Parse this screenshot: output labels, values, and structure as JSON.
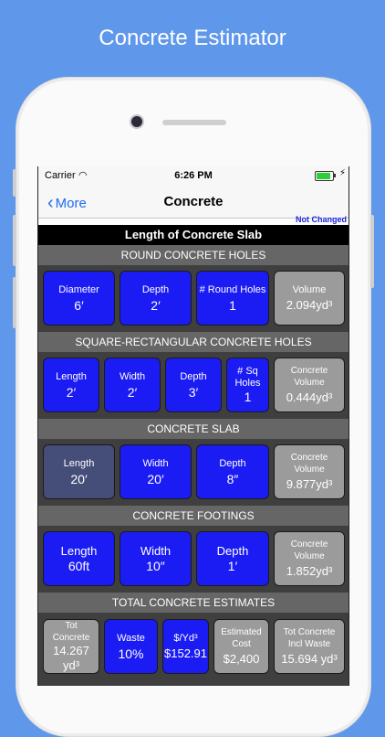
{
  "headline": "Concrete Estimator",
  "status": {
    "carrier": "Carrier",
    "time": "6:26 PM"
  },
  "nav": {
    "back": "More",
    "title": "Concrete"
  },
  "note": "Not Changed",
  "title": "Length of Concrete Slab",
  "round_holes": {
    "header": "ROUND CONCRETE HOLES",
    "diameter": {
      "label": "Diameter",
      "value": "6′"
    },
    "depth": {
      "label": "Depth",
      "value": "2′"
    },
    "count": {
      "label": "# Round Holes",
      "value": "1"
    },
    "volume": {
      "label": "Volume",
      "value": "2.094yd³"
    }
  },
  "square_holes": {
    "header": "SQUARE-RECTANGULAR  CONCRETE HOLES",
    "length": {
      "label": "Length",
      "value": "2′"
    },
    "width": {
      "label": "Width",
      "value": "2′"
    },
    "depth": {
      "label": "Depth",
      "value": "3′"
    },
    "count": {
      "label1": "# Sq",
      "label2": "Holes",
      "value": "1"
    },
    "volume": {
      "label1": "Concrete",
      "label2": "Volume",
      "value": "0.444yd³"
    }
  },
  "slab": {
    "header": "CONCRETE SLAB",
    "length": {
      "label": "Length",
      "value": "20′"
    },
    "width": {
      "label": "Width",
      "value": "20′"
    },
    "depth": {
      "label": "Depth",
      "value": "8″"
    },
    "volume": {
      "label1": "Concrete",
      "label2": "Volume",
      "value": "9.877yd³"
    }
  },
  "footings": {
    "header": "CONCRETE FOOTINGS",
    "length": {
      "label": "Length",
      "value": "60ft"
    },
    "width": {
      "label": "Width",
      "value": "10″"
    },
    "depth": {
      "label": "Depth",
      "value": "1′"
    },
    "volume": {
      "label1": "Concrete",
      "label2": "Volume",
      "value": "1.852yd³"
    }
  },
  "totals": {
    "header": "TOTAL CONCRETE ESTIMATES",
    "tot": {
      "label1": "Tot",
      "label2": "Concrete",
      "value1": "14.267",
      "value2": "yd³"
    },
    "waste": {
      "label": "Waste",
      "value": "10%"
    },
    "price": {
      "label": "$/Yd³",
      "value": "$152.91"
    },
    "cost": {
      "label1": "Estimated",
      "label2": "Cost",
      "value": "$2,400"
    },
    "incl": {
      "label1": "Tot Concrete",
      "label2": "Incl Waste",
      "value": "15.694 yd³"
    }
  },
  "colors": {
    "accent": "#1b1cf3",
    "background": "#5f97ea",
    "selected": "#454e79",
    "readonly": "#9b9b9b"
  }
}
